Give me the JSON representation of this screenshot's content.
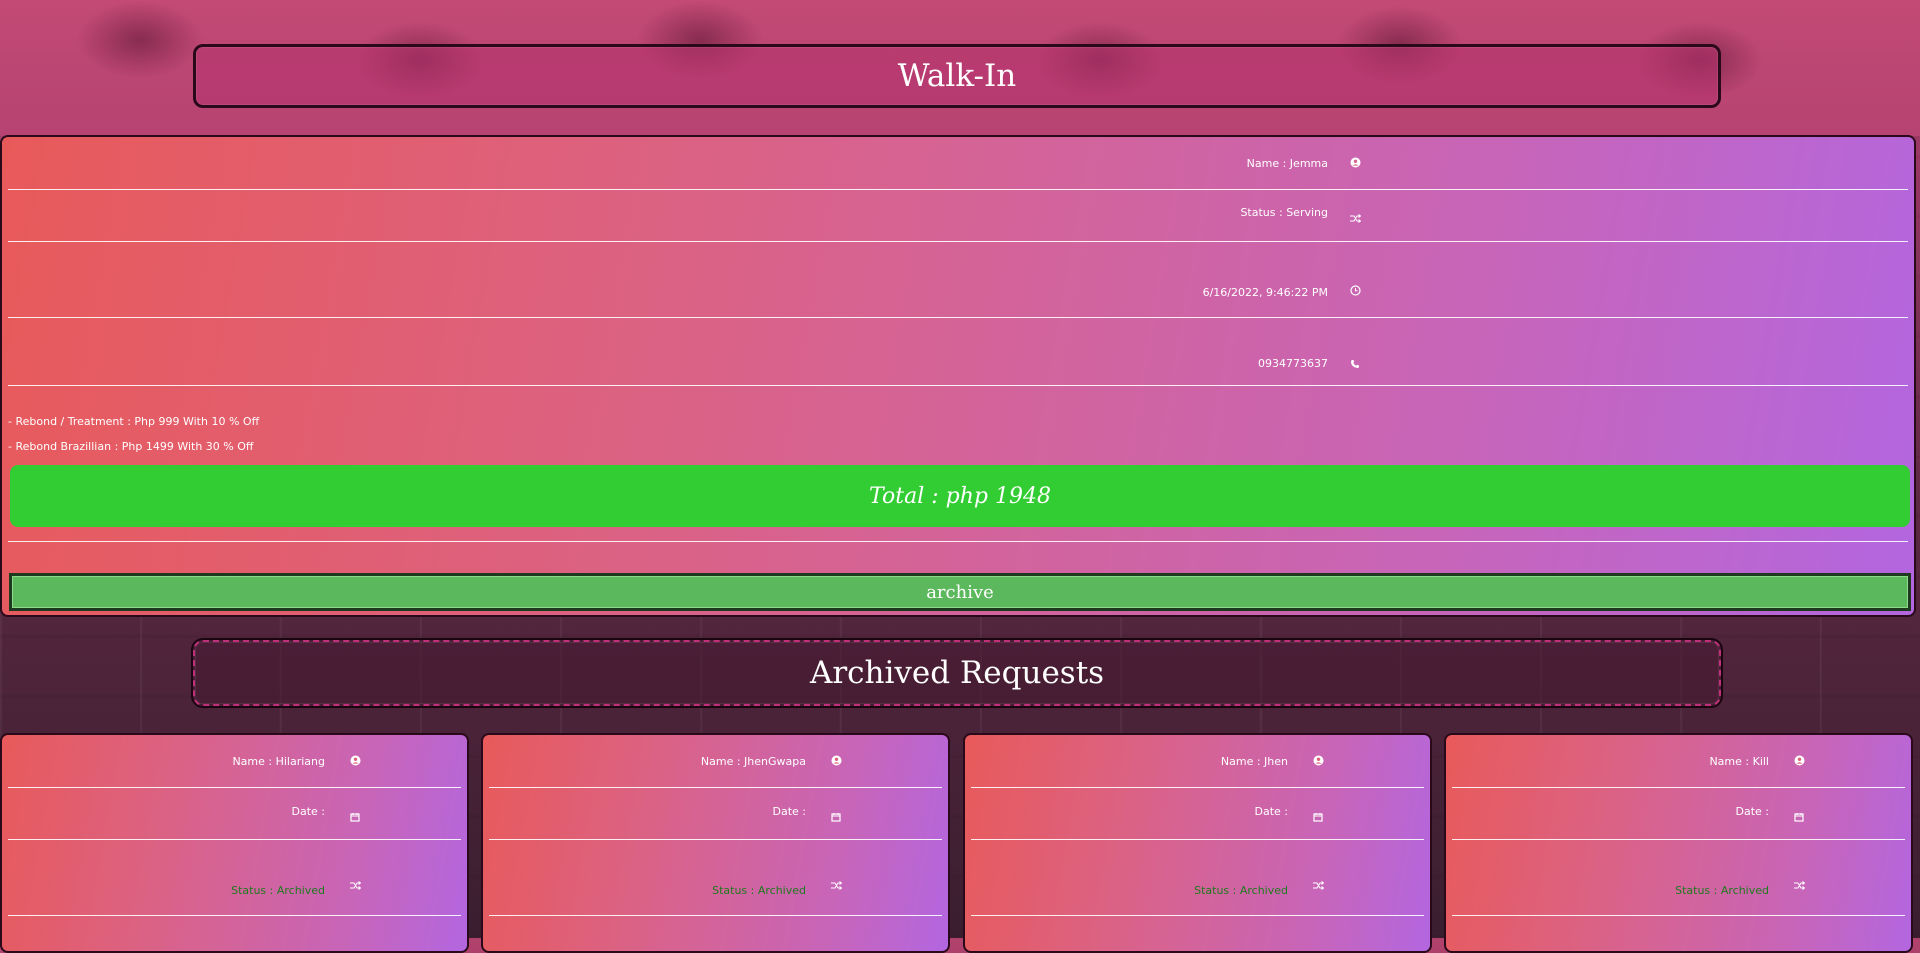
{
  "walkin": {
    "title": "Walk-In",
    "name": "Name : Jemma",
    "status": "Status : Serving",
    "datetime": "6/16/2022, 9:46:22 PM",
    "phone": "0934773637",
    "services": [
      "- Rebond / Treatment : Php 999 With 10 % Off",
      "- Rebond Brazillian : Php 1499 With 30 % Off"
    ],
    "total": "Total : php 1948",
    "archive_label": "archive"
  },
  "archived": {
    "title": "Archived Requests",
    "cards": [
      {
        "name": "Name : Hilariang",
        "date": "Date :",
        "status": "Status : Archived"
      },
      {
        "name": "Name : JhenGwapa",
        "date": "Date :",
        "status": "Status : Archived"
      },
      {
        "name": "Name : Jhen",
        "date": "Date :",
        "status": "Status : Archived"
      },
      {
        "name": "Name : Kill",
        "date": "Date :",
        "status": "Status : Archived"
      }
    ]
  },
  "icons": {
    "name": "user-circle-icon",
    "status": "shuffle-icon",
    "time": "clock-icon",
    "phone": "phone-icon",
    "date": "calendar-icon"
  },
  "colors": {
    "total_bg": "#32cd32",
    "archive_bg": "#5cb85c",
    "archived_status": "#1e7a1e"
  }
}
